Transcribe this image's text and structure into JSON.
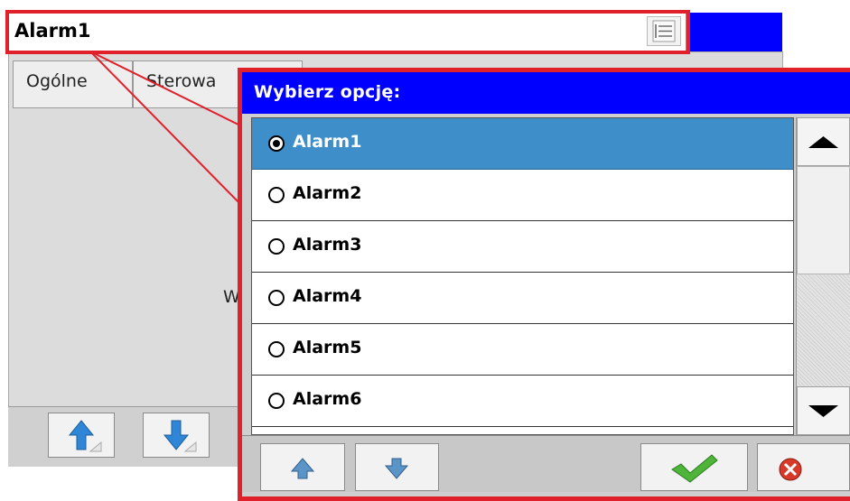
{
  "field": {
    "value": "Alarm1",
    "list_button_icon": "list-icon"
  },
  "tabs": [
    {
      "label": "Ogólne"
    },
    {
      "label": "Sterowa"
    }
  ],
  "background": {
    "partial_label": "W",
    "toolbar": {
      "up_icon": "arrow-up-icon",
      "down_icon": "arrow-down-icon"
    }
  },
  "dialog": {
    "title": "Wybierz opcję:",
    "options": [
      {
        "label": "Alarm1",
        "selected": true
      },
      {
        "label": "Alarm2",
        "selected": false
      },
      {
        "label": "Alarm3",
        "selected": false
      },
      {
        "label": "Alarm4",
        "selected": false
      },
      {
        "label": "Alarm5",
        "selected": false
      },
      {
        "label": "Alarm6",
        "selected": false
      }
    ],
    "buttons": {
      "up_icon": "arrow-up-icon",
      "down_icon": "arrow-down-icon",
      "ok_icon": "checkmark-icon",
      "cancel_icon": "cancel-icon"
    }
  },
  "colors": {
    "title_bar": "#0000ff",
    "selection": "#3d8ec9",
    "highlight_outline": "#e0202a"
  }
}
